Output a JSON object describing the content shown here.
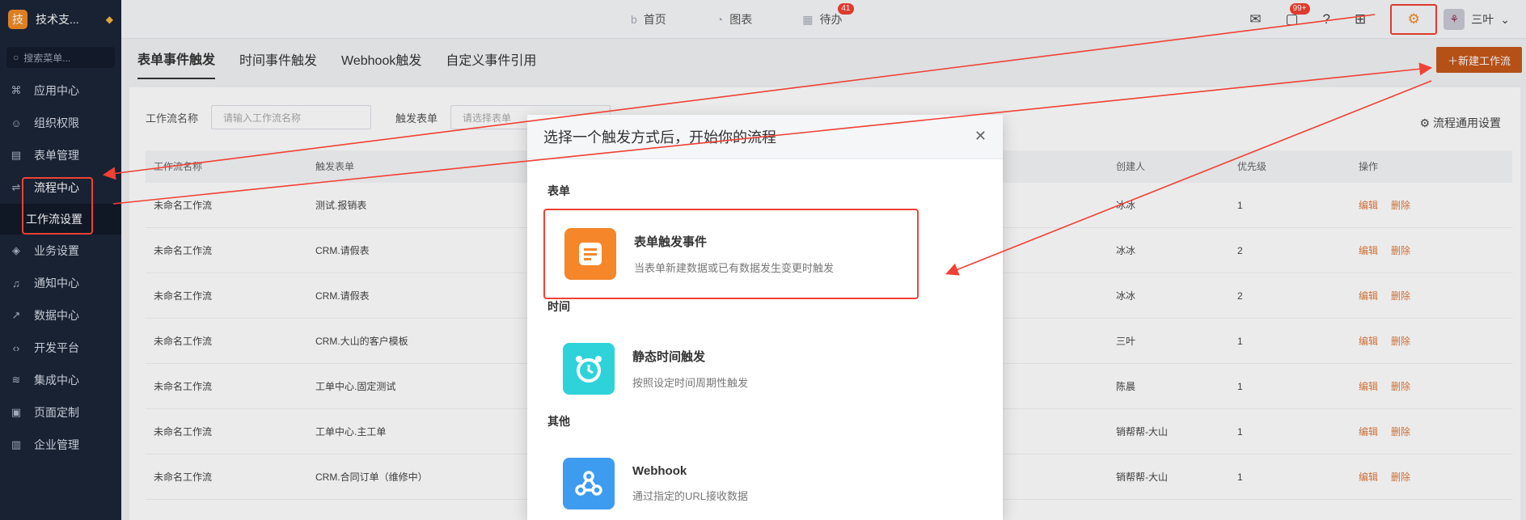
{
  "sidebar": {
    "brand_logo": "技",
    "brand_name": "技术支...",
    "search_placeholder": "搜索菜单...",
    "items": [
      {
        "label": "应用中心",
        "icon": "grid-icon"
      },
      {
        "label": "组织权限",
        "icon": "user-icon"
      },
      {
        "label": "表单管理",
        "icon": "form-icon"
      },
      {
        "label": "流程中心",
        "icon": "flow-icon"
      },
      {
        "label": "业务设置",
        "icon": "cube-icon"
      },
      {
        "label": "通知中心",
        "icon": "bell-icon"
      },
      {
        "label": "数据中心",
        "icon": "chart-icon"
      },
      {
        "label": "开发平台",
        "icon": "code-icon"
      },
      {
        "label": "集成中心",
        "icon": "layers-icon"
      },
      {
        "label": "页面定制",
        "icon": "layout-icon"
      },
      {
        "label": "企业管理",
        "icon": "building-icon"
      }
    ],
    "sub_item": "工作流设置"
  },
  "topbar": {
    "nav": [
      {
        "label": "首页",
        "icon": "home-icon"
      },
      {
        "label": "图表",
        "icon": "pie-icon"
      },
      {
        "label": "待办",
        "icon": "calendar-icon",
        "badge": "41"
      }
    ],
    "message_badge": "99+",
    "user_name": "三叶",
    "avatar_char": "⚘"
  },
  "tabs": [
    "表单事件触发",
    "时间事件触发",
    "Webhook触发",
    "自定义事件引用"
  ],
  "new_button": "＋新建工作流",
  "filters": {
    "name_label": "工作流名称",
    "name_placeholder": "请输入工作流名称",
    "form_label": "触发表单",
    "form_placeholder": "请选择表单"
  },
  "flow_settings": "流程通用设置",
  "table": {
    "headers": {
      "name": "工作流名称",
      "form": "触发表单",
      "creator": "创建人",
      "priority": "优先级",
      "ops": "操作"
    },
    "rows": [
      {
        "name": "未命名工作流",
        "form": "测试.报销表",
        "creator": "冰冰",
        "priority": "1",
        "edit": "编辑",
        "del": "删除"
      },
      {
        "name": "未命名工作流",
        "form": "CRM.请假表",
        "creator": "冰冰",
        "priority": "2",
        "edit": "编辑",
        "del": "删除"
      },
      {
        "name": "未命名工作流",
        "form": "CRM.请假表",
        "creator": "冰冰",
        "priority": "2",
        "edit": "编辑",
        "del": "删除"
      },
      {
        "name": "未命名工作流",
        "form": "CRM.大山的客户模板",
        "creator": "三叶",
        "priority": "1",
        "edit": "编辑",
        "del": "删除"
      },
      {
        "name": "未命名工作流",
        "form": "工单中心.固定测试",
        "creator": "陈晨",
        "priority": "1",
        "edit": "编辑",
        "del": "删除"
      },
      {
        "name": "未命名工作流",
        "form": "工单中心.主工单",
        "creator": "销帮帮-大山",
        "priority": "1",
        "edit": "编辑",
        "del": "删除"
      },
      {
        "name": "未命名工作流",
        "form": "CRM.合同订单（维修中）",
        "creator": "销帮帮-大山",
        "priority": "1",
        "edit": "编辑",
        "del": "删除"
      }
    ]
  },
  "modal": {
    "title": "选择一个触发方式后，开始你的流程",
    "groups": [
      "表单",
      "时间",
      "其他"
    ],
    "options": [
      {
        "title": "表单触发事件",
        "desc": "当表单新建数据或已有数据发生变更时触发",
        "color": "#f5862a"
      },
      {
        "title": "静态时间触发",
        "desc": "按照设定时间周期性触发",
        "color": "#2ed3da"
      },
      {
        "title": "Webhook",
        "desc": "通过指定的URL接收数据",
        "color": "#3d9bf0"
      }
    ]
  },
  "colors": {
    "accent": "#f08a24",
    "annotation": "#f04134",
    "sidebar": "#1b2538"
  }
}
